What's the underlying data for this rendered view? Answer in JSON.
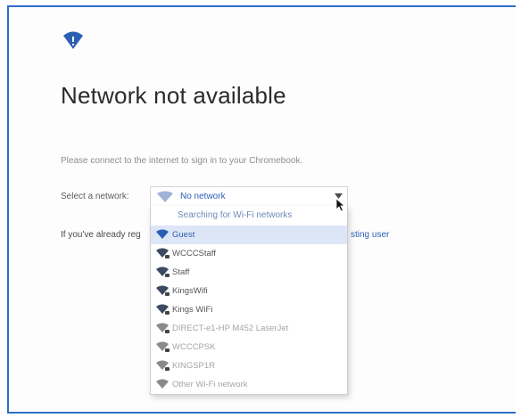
{
  "colors": {
    "accent": "#2a5fb4",
    "frame": "#2f6fc8",
    "selected_bg": "#dde6f7"
  },
  "header": {
    "logo_icon": "wifi-icon",
    "title": "Network not available"
  },
  "instruction": "Please connect to the internet to sign in to your Chromebook.",
  "network_select": {
    "label": "Select a network:",
    "value": "No network",
    "icon": "wifi-icon"
  },
  "background_text": {
    "prefix": "If you've already reg",
    "link_fragment": "sting user"
  },
  "dropdown": {
    "searching_label": "Searching for Wi-Fi networks",
    "items": [
      {
        "label": "Guest",
        "secured": false,
        "selected": true
      },
      {
        "label": "WCCCStaff",
        "secured": true
      },
      {
        "label": "Staff",
        "secured": true
      },
      {
        "label": "KingsWifi",
        "secured": true
      },
      {
        "label": "Kings WiFi",
        "secured": true
      },
      {
        "label": "DIRECT-e1-HP M452 LaserJet",
        "secured": true,
        "faded": true
      },
      {
        "label": "WCCCPSK",
        "secured": true,
        "faded": true
      },
      {
        "label": "KINGSP1R",
        "secured": true,
        "faded": true
      },
      {
        "label": "Other Wi-Fi network",
        "secured": false,
        "faded": true
      }
    ]
  }
}
